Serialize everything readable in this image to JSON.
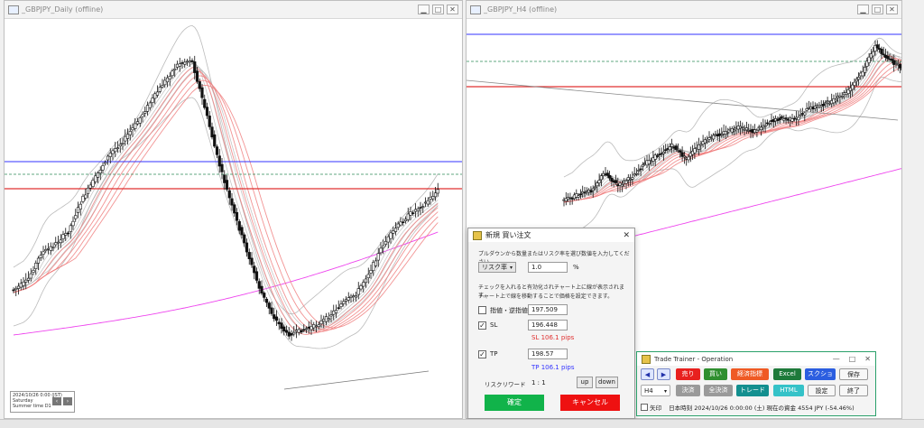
{
  "left_window": {
    "title": "_GBPJPY_Daily (offline)",
    "info_lines": [
      "2024/10/26 0:00 (JST)",
      "Saturday",
      "Summer time  D1"
    ]
  },
  "right_window": {
    "title": "_GBPJPY_H4 (offline)"
  },
  "order_dialog": {
    "title": "新規 買い注文",
    "instruction": "プルダウンから数量またはリスク率を選び数値を入力してください。",
    "risk_mode": "リスク率",
    "risk_value": "1.0",
    "risk_unit": "%",
    "note1": "チェックを入れると有効化されチャート上に線が表示されます。",
    "note2": "チャート上で線を移動することで価格を設定できます。",
    "limit_label": "指値・逆指値",
    "limit_value": "197.509",
    "sl_label": "SL",
    "sl_value": "196.448",
    "sl_pips": "SL 106.1 pips",
    "tp_label": "TP",
    "tp_value": "198.57",
    "tp_pips": "TP 106.1 pips",
    "rr_label": "リスクリワード",
    "rr_value": "1 : 1",
    "up_label": "up",
    "down_label": "down",
    "confirm_label": "確定",
    "cancel_label": "キャンセル"
  },
  "trade_trainer": {
    "title": "Trade Trainer - Operation",
    "sell_label": "売り",
    "buy_label": "買い",
    "econ_label": "経済指標",
    "excel_label": "Excel",
    "screenshot_label": "スクショ",
    "save_label": "保存",
    "timeframe": "H4",
    "settle_label": "決済",
    "settle_all_label": "全決済",
    "trade_label": "トレード",
    "html_label": "HTML",
    "settings_label": "設定",
    "exit_label": "終了",
    "arrow_label": "矢印",
    "status_text": "日本時刻  2024/10/26 0:00:00 (土)   現在の資金 4554 JPY (-54.46%)"
  },
  "colors": {
    "bull": "#ffffff",
    "bear": "#111111",
    "tp_line": "#3333ff",
    "entry_line": "#2e8b57",
    "sl_line": "#e03030",
    "ma_red": "#f08080",
    "ma_gray": "#b0b0b0",
    "ma_magenta": "#ee44ee"
  }
}
